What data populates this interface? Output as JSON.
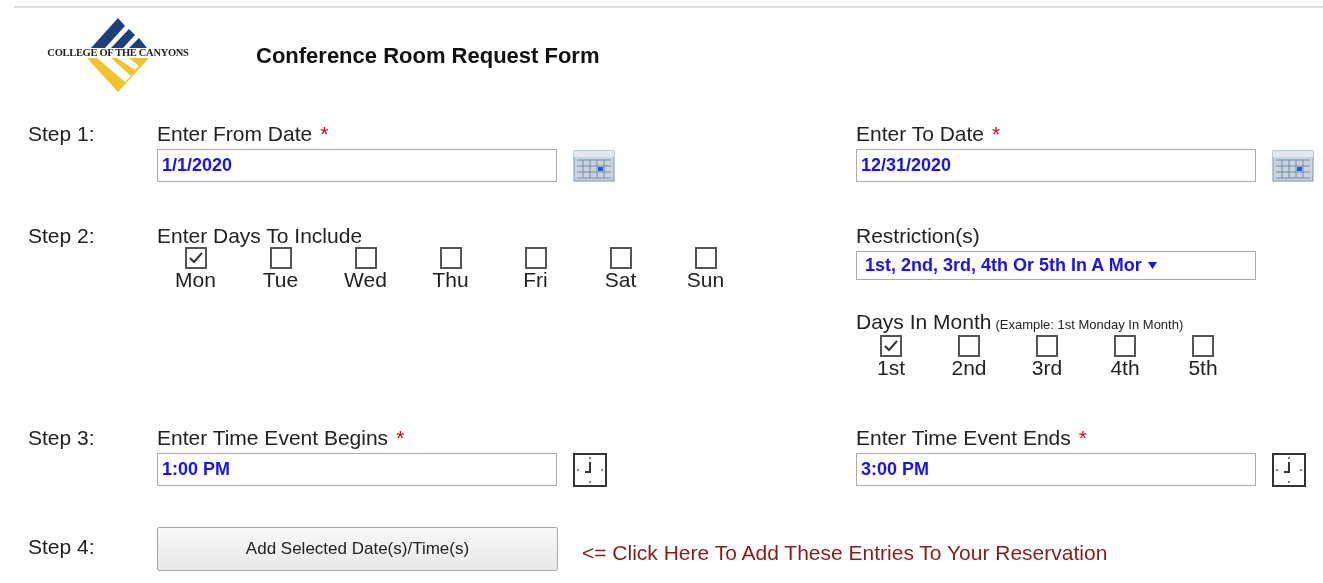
{
  "logo": {
    "text": "COLLEGE OF THE CANYONS"
  },
  "title": "Conference Room Request Form",
  "step1": {
    "label": "Step 1:",
    "from": {
      "label": "Enter From Date",
      "required_mark": "*",
      "value": "1/1/2020"
    },
    "to": {
      "label": "Enter To Date",
      "required_mark": "*",
      "value": "12/31/2020"
    }
  },
  "step2": {
    "label": "Step 2:",
    "days_label": "Enter Days To Include",
    "days": [
      {
        "label": "Mon",
        "checked": true
      },
      {
        "label": "Tue",
        "checked": false
      },
      {
        "label": "Wed",
        "checked": false
      },
      {
        "label": "Thu",
        "checked": false
      },
      {
        "label": "Fri",
        "checked": false
      },
      {
        "label": "Sat",
        "checked": false
      },
      {
        "label": "Sun",
        "checked": false
      }
    ],
    "restriction_label": "Restriction(s)",
    "restriction_value": "1st, 2nd, 3rd, 4th Or 5th In A Mor",
    "month_label": "Days In Month",
    "month_hint": "(Example: 1st Monday In Month)",
    "month_days": [
      {
        "label": "1st",
        "checked": true
      },
      {
        "label": "2nd",
        "checked": false
      },
      {
        "label": "3rd",
        "checked": false
      },
      {
        "label": "4th",
        "checked": false
      },
      {
        "label": "5th",
        "checked": false
      }
    ]
  },
  "step3": {
    "label": "Step 3:",
    "begins": {
      "label": "Enter Time Event Begins",
      "required_mark": "*",
      "value": "1:00 PM"
    },
    "ends": {
      "label": "Enter Time Event Ends",
      "required_mark": "*",
      "value": "3:00 PM"
    }
  },
  "step4": {
    "label": "Step 4:",
    "button": "Add Selected Date(s)/Time(s)",
    "hint": "<= Click Here To Add These Entries To Your Reservation"
  }
}
